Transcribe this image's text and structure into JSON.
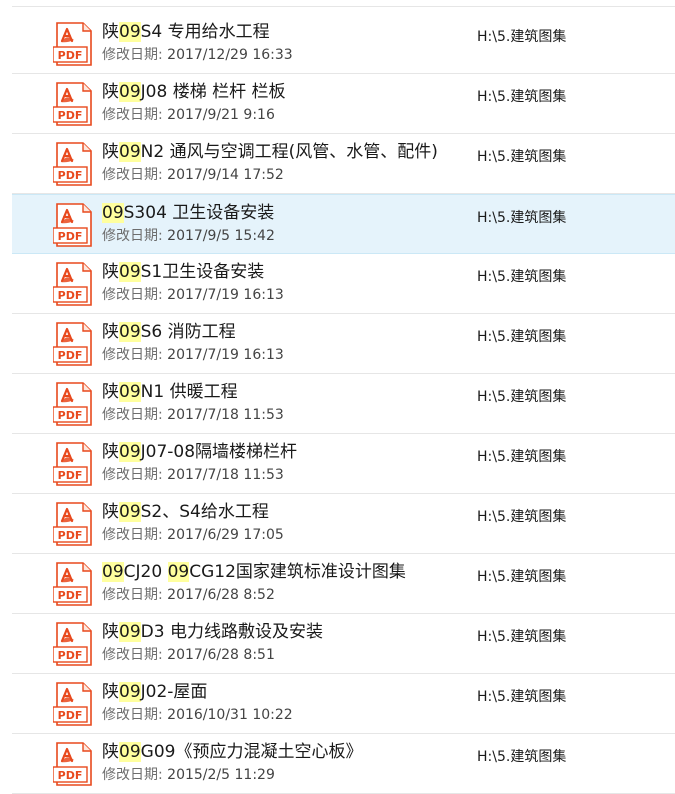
{
  "date_label": "修改日期:",
  "items": [
    {
      "title_parts": [
        {
          "t": "陕",
          "h": false
        },
        {
          "t": "09",
          "h": true
        },
        {
          "t": "S4 专用给水工程",
          "h": false
        }
      ],
      "date": "2017/12/29 16:33",
      "location": "H:\\5.建筑图集",
      "selected": false
    },
    {
      "title_parts": [
        {
          "t": "陕",
          "h": false
        },
        {
          "t": "09",
          "h": true
        },
        {
          "t": "J08 楼梯 栏杆 栏板",
          "h": false
        }
      ],
      "date": "2017/9/21 9:16",
      "location": "H:\\5.建筑图集",
      "selected": false
    },
    {
      "title_parts": [
        {
          "t": "陕",
          "h": false
        },
        {
          "t": "09",
          "h": true
        },
        {
          "t": "N2 通风与空调工程(风管、水管、配件)",
          "h": false
        }
      ],
      "date": "2017/9/14 17:52",
      "location": "H:\\5.建筑图集",
      "selected": false
    },
    {
      "title_parts": [
        {
          "t": "09",
          "h": true
        },
        {
          "t": "S304 卫生设备安装",
          "h": false
        }
      ],
      "date": "2017/9/5 15:42",
      "location": "H:\\5.建筑图集",
      "selected": true
    },
    {
      "title_parts": [
        {
          "t": "陕",
          "h": false
        },
        {
          "t": "09",
          "h": true
        },
        {
          "t": "S1卫生设备安装",
          "h": false
        }
      ],
      "date": "2017/7/19 16:13",
      "location": "H:\\5.建筑图集",
      "selected": false
    },
    {
      "title_parts": [
        {
          "t": "陕",
          "h": false
        },
        {
          "t": "09",
          "h": true
        },
        {
          "t": "S6 消防工程",
          "h": false
        }
      ],
      "date": "2017/7/19 16:13",
      "location": "H:\\5.建筑图集",
      "selected": false
    },
    {
      "title_parts": [
        {
          "t": "陕",
          "h": false
        },
        {
          "t": "09",
          "h": true
        },
        {
          "t": "N1 供暖工程",
          "h": false
        }
      ],
      "date": "2017/7/18 11:53",
      "location": "H:\\5.建筑图集",
      "selected": false
    },
    {
      "title_parts": [
        {
          "t": "陕",
          "h": false
        },
        {
          "t": "09",
          "h": true
        },
        {
          "t": "J07-08隔墙楼梯栏杆",
          "h": false
        }
      ],
      "date": "2017/7/18 11:53",
      "location": "H:\\5.建筑图集",
      "selected": false
    },
    {
      "title_parts": [
        {
          "t": "陕",
          "h": false
        },
        {
          "t": "09",
          "h": true
        },
        {
          "t": "S2、S4给水工程",
          "h": false
        }
      ],
      "date": "2017/6/29 17:05",
      "location": "H:\\5.建筑图集",
      "selected": false
    },
    {
      "title_parts": [
        {
          "t": "09",
          "h": true
        },
        {
          "t": "CJ20 ",
          "h": false
        },
        {
          "t": "09",
          "h": true
        },
        {
          "t": "CG12国家建筑标准设计图集",
          "h": false
        }
      ],
      "date": "2017/6/28 8:52",
      "location": "H:\\5.建筑图集",
      "selected": false
    },
    {
      "title_parts": [
        {
          "t": "陕",
          "h": false
        },
        {
          "t": "09",
          "h": true
        },
        {
          "t": "D3 电力线路敷设及安装",
          "h": false
        }
      ],
      "date": "2017/6/28 8:51",
      "location": "H:\\5.建筑图集",
      "selected": false
    },
    {
      "title_parts": [
        {
          "t": "陕",
          "h": false
        },
        {
          "t": "09",
          "h": true
        },
        {
          "t": "J02-屋面",
          "h": false
        }
      ],
      "date": "2016/10/31 10:22",
      "location": "H:\\5.建筑图集",
      "selected": false
    },
    {
      "title_parts": [
        {
          "t": "陕",
          "h": false
        },
        {
          "t": "09",
          "h": true
        },
        {
          "t": "G09《预应力混凝土空心板》",
          "h": false
        }
      ],
      "date": "2015/2/5 11:29",
      "location": "H:\\5.建筑图集",
      "selected": false
    }
  ],
  "icon": {
    "name": "pdf-file-icon",
    "text": "PDF",
    "color": "#e8491d"
  }
}
